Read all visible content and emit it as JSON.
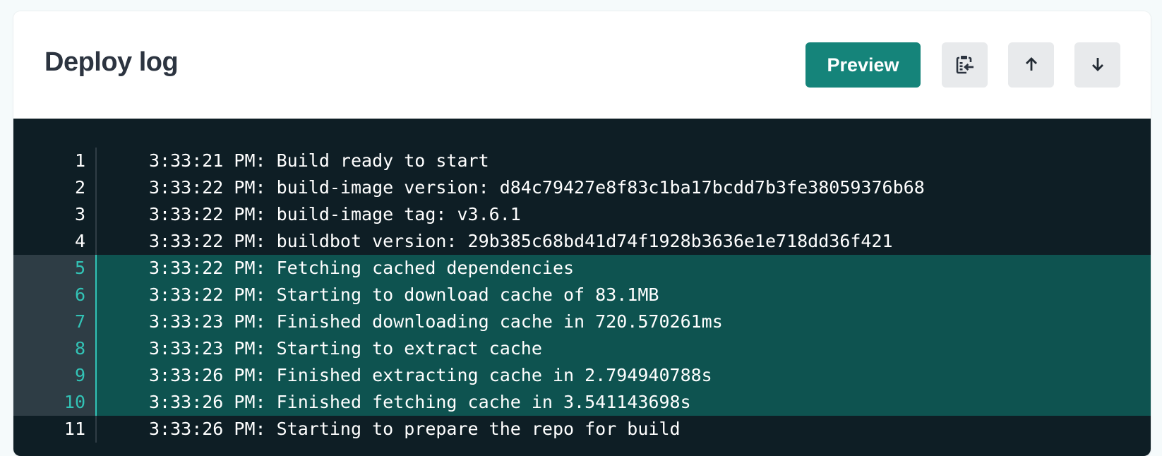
{
  "header": {
    "title": "Deploy log",
    "preview_label": "Preview",
    "icons": {
      "copy": "clipboard-copy-icon",
      "up": "arrow-up-icon",
      "down": "arrow-down-icon"
    }
  },
  "colors": {
    "accent": "#15847a",
    "log_background": "#0e1e25",
    "highlight_background": "#0e5350",
    "highlight_line_number": "#32c3b6"
  },
  "log": {
    "lines": [
      {
        "num": "1",
        "text": "3:33:21 PM: Build ready to start",
        "highlighted": false
      },
      {
        "num": "2",
        "text": "3:33:22 PM: build-image version: d84c79427e8f83c1ba17bcdd7b3fe38059376b68",
        "highlighted": false
      },
      {
        "num": "3",
        "text": "3:33:22 PM: build-image tag: v3.6.1",
        "highlighted": false
      },
      {
        "num": "4",
        "text": "3:33:22 PM: buildbot version: 29b385c68bd41d74f1928b3636e1e718dd36f421",
        "highlighted": false
      },
      {
        "num": "5",
        "text": "3:33:22 PM: Fetching cached dependencies",
        "highlighted": true
      },
      {
        "num": "6",
        "text": "3:33:22 PM: Starting to download cache of 83.1MB",
        "highlighted": true
      },
      {
        "num": "7",
        "text": "3:33:23 PM: Finished downloading cache in 720.570261ms",
        "highlighted": true
      },
      {
        "num": "8",
        "text": "3:33:23 PM: Starting to extract cache",
        "highlighted": true
      },
      {
        "num": "9",
        "text": "3:33:26 PM: Finished extracting cache in 2.794940788s",
        "highlighted": true
      },
      {
        "num": "10",
        "text": "3:33:26 PM: Finished fetching cache in 3.541143698s",
        "highlighted": true
      },
      {
        "num": "11",
        "text": "3:33:26 PM: Starting to prepare the repo for build",
        "highlighted": false
      }
    ]
  }
}
